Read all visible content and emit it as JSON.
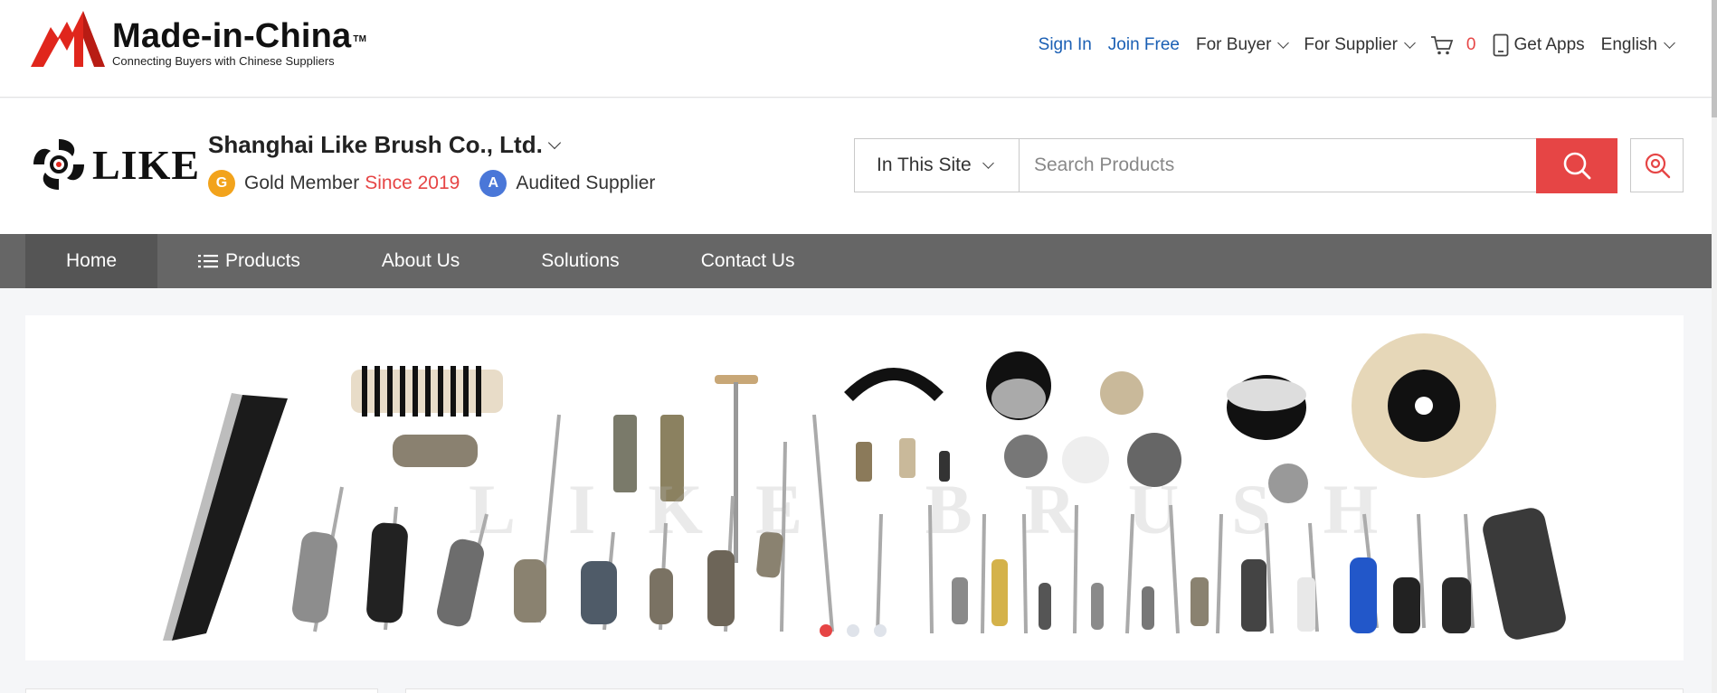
{
  "site": {
    "logo_name": "Made-in-China",
    "logo_tm": "TM",
    "logo_slogan": "Connecting Buyers with Chinese Suppliers"
  },
  "toplinks": {
    "sign_in": "Sign In",
    "join_free": "Join Free",
    "for_buyer": "For Buyer",
    "for_supplier": "For Supplier",
    "cart_count": "0",
    "get_apps": "Get Apps",
    "language": "English"
  },
  "company": {
    "logo_word": "LIKE",
    "name": "Shanghai Like Brush Co., Ltd.",
    "gold_member": "Gold Member",
    "since": "Since 2019",
    "audited": "Audited Supplier"
  },
  "search": {
    "scope": "In This Site",
    "placeholder": "Search Products"
  },
  "nav": {
    "items": [
      {
        "label": "Home"
      },
      {
        "label": "Products"
      },
      {
        "label": "About Us"
      },
      {
        "label": "Solutions"
      },
      {
        "label": "Contact Us"
      }
    ]
  },
  "banner": {
    "watermark": "LIKE BRUSH",
    "slides": 3,
    "active_slide": 1
  },
  "colors": {
    "accent_red": "#e64545",
    "link_blue": "#1a5fb4",
    "nav_gray": "#666666"
  }
}
